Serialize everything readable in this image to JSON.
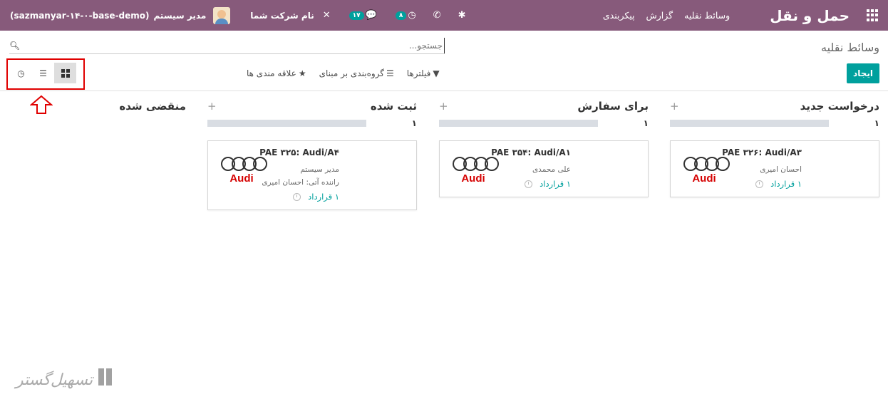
{
  "navbar": {
    "brand": "حمل و نقل",
    "menu": [
      "وسائط نقلیه",
      "گزارش",
      "پیکربندی"
    ],
    "company": "نام شرکت شما",
    "activity_count": "۸",
    "messages_count": "۱۷",
    "user": "مدیر سیستم",
    "database": "(sazmanyar-۱۴-۰-base-demo)"
  },
  "control_panel": {
    "breadcrumb": "وسائط نقلیه",
    "search_placeholder": "جستجو...",
    "create_label": "ایجاد",
    "filters_label": "فیلترها",
    "groupby_label": "گروه‌بندی بر مبنای",
    "favorites_label": "علاقه مندی ها"
  },
  "columns": [
    {
      "title": "درخواست جدید",
      "count": "۱",
      "card": {
        "title": "PAE ۳۲۶: Audi/A۳",
        "lines": [
          "احسان امیری"
        ],
        "link": "۱ قرارداد",
        "brand": "Audi"
      }
    },
    {
      "title": "برای سفارش",
      "count": "۱",
      "card": {
        "title": "PAE ۳۵۴: Audi/A۱",
        "lines": [
          "علی محمدی"
        ],
        "link": "۱ قرارداد",
        "brand": "Audi"
      }
    },
    {
      "title": "ثبت شده",
      "count": "۱",
      "card": {
        "title": "PAE ۳۲۵: Audi/A۴",
        "lines": [
          "مدیر سیستم",
          "راننده آتی: احسان امیری"
        ],
        "link": "۱ قرارداد",
        "brand": "Audi"
      }
    },
    {
      "title": "منقضی شده"
    }
  ],
  "watermark": "تسهیل‌گستر",
  "colors": {
    "navbar": "#875a7b",
    "primary": "#00a09d",
    "highlight": "#e00000",
    "audi_red": "#d50000"
  }
}
